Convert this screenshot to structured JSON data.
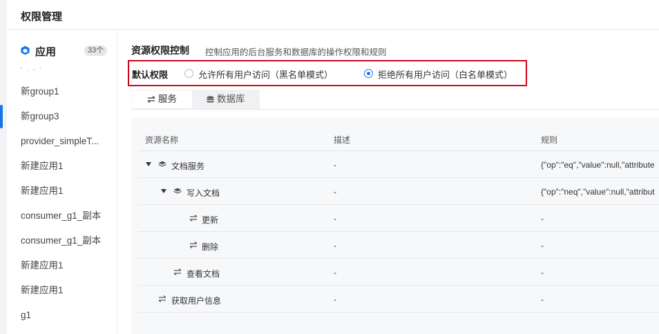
{
  "header": {
    "title": "权限管理"
  },
  "sidebar": {
    "app_title": "应用",
    "app_count": "33个",
    "truncated_row": "' · - '",
    "items": [
      {
        "label": "新group1"
      },
      {
        "label": "新group3"
      },
      {
        "label": "provider_simpleT..."
      },
      {
        "label": "新建应用1"
      },
      {
        "label": "新建应用1"
      },
      {
        "label": "consumer_g1_副本"
      },
      {
        "label": "consumer_g1_副本"
      },
      {
        "label": "新建应用1"
      },
      {
        "label": "新建应用1"
      },
      {
        "label": "g1"
      }
    ]
  },
  "main": {
    "section_title": "资源权限控制",
    "section_desc": "控制应用的后台服务和数据库的操作权限和规则",
    "default_permission": {
      "label": "默认权限",
      "options": [
        {
          "label": "允许所有用户访问（黑名单模式）",
          "checked": false
        },
        {
          "label": "拒绝所有用户访问（白名单模式）",
          "checked": true
        }
      ]
    },
    "tabs": [
      {
        "label": "服务",
        "icon": "swap-arrows-icon",
        "active": true
      },
      {
        "label": "数据库",
        "icon": "database-icon",
        "active": false
      }
    ],
    "table": {
      "columns": [
        "资源名称",
        "描述",
        "规则"
      ],
      "rows": [
        {
          "name": "文档服务",
          "desc": "-",
          "rule": "{\"op\":\"eq\",\"value\":null,\"attribute",
          "expanded": true,
          "icon": "layers-icon"
        },
        {
          "name": "写入文档",
          "desc": "-",
          "rule": "{\"op\":\"neq\",\"value\":null,\"attribut",
          "expanded": true,
          "icon": "layers-icon"
        },
        {
          "name": "更新",
          "desc": "-",
          "rule": "-",
          "icon": "swap-arrows-icon"
        },
        {
          "name": "删除",
          "desc": "-",
          "rule": "-",
          "icon": "swap-arrows-icon"
        },
        {
          "name": "查看文档",
          "desc": "-",
          "rule": "-",
          "icon": "swap-arrows-icon"
        },
        {
          "name": "获取用户信息",
          "desc": "-",
          "rule": "-",
          "icon": "swap-arrows-icon"
        }
      ]
    }
  },
  "colors": {
    "accent": "#1a73e8",
    "highlight_border": "#d0021b"
  }
}
